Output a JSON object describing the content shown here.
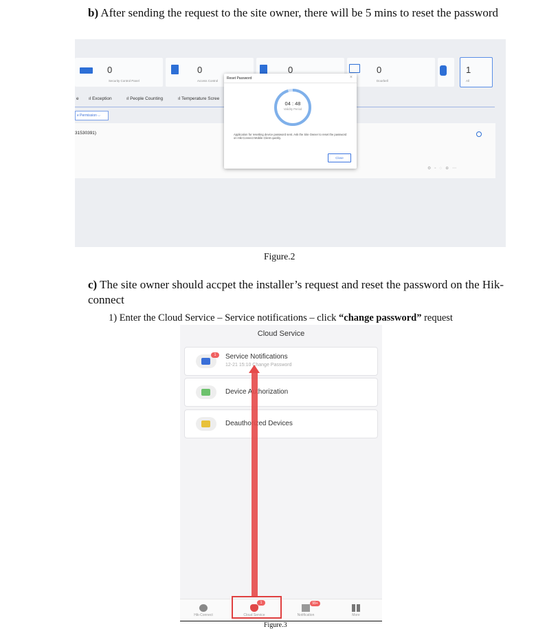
{
  "doc": {
    "section_b": {
      "marker": "b)",
      "text": " After sending the request to the site owner, there will be 5 mins to reset the password"
    },
    "figure2_caption": "Figure.2",
    "section_c": {
      "marker": "c)",
      "text": " The site owner should accpet the installer’s request and reset the password on the Hik-connect"
    },
    "step1": {
      "prefix": "1) Enter the Cloud Service – Service notifications – click ",
      "bold": "“change password”",
      "suffix": " request"
    },
    "figure3_caption": "Figure.3"
  },
  "web": {
    "cards": [
      {
        "num": "0",
        "label": "Security Control Panel"
      },
      {
        "num": "0",
        "label": "Access Control"
      },
      {
        "num": "0",
        "label": ""
      },
      {
        "num": "0",
        "label": "Doorbell"
      },
      {
        "num": "1",
        "label": "All"
      }
    ],
    "tabs": [
      "Exception",
      "People Counting",
      "Temperature Scree"
    ],
    "tab_left_fragment": "e",
    "permission": "e Permission",
    "serial": "31530391)",
    "dialog": {
      "title": "Reset Password",
      "close_x": "×",
      "timer": "04 : 48",
      "validity": "Validity Period",
      "message": "Application for resetting device password sent. Ask the Site Owner to reset the password on Hik-Connect Mobile Client quickly.",
      "close_button": "Close"
    },
    "accent": "#2d6fd6"
  },
  "mobile": {
    "title": "Cloud Service",
    "items": [
      {
        "label": "Service Notifications",
        "sub": "12-21 15:10 Change Password",
        "badge": "1"
      },
      {
        "label": "Device Authorization"
      },
      {
        "label": "Deauthorized Devices"
      }
    ],
    "nav": [
      {
        "label": "Hik-Connect"
      },
      {
        "label": "Cloud Service",
        "badge": "1"
      },
      {
        "label": "Notification",
        "badge": "99+"
      },
      {
        "label": "More"
      }
    ],
    "arrow_color": "#e64a4a"
  }
}
